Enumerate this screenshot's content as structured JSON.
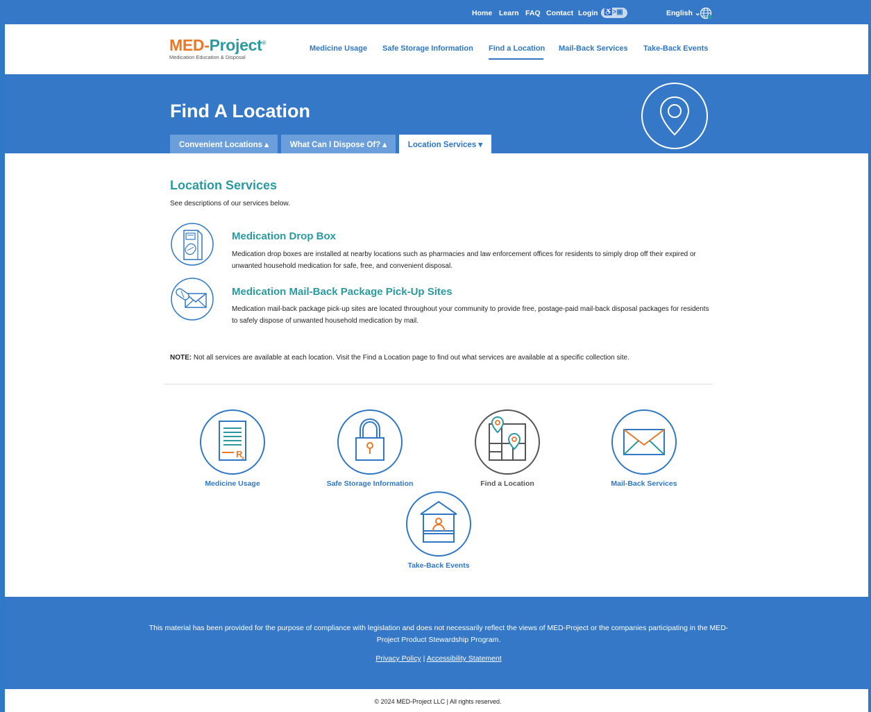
{
  "topbar": {
    "links": [
      "Home",
      "Learn",
      "FAQ",
      "Contact",
      "Login"
    ],
    "accessibility_badge": "♿>▣",
    "language": "English",
    "language_chevron": "⌄"
  },
  "header": {
    "logo_main_1": "MED-",
    "logo_main_2": "Project",
    "logo_reg": "®",
    "logo_sub": "Medication Education & Disposal",
    "nav": [
      "Medicine Usage",
      "Safe Storage Information",
      "Find a Location",
      "Mail-Back Services",
      "Take-Back Events"
    ],
    "active_nav": "Find a Location"
  },
  "hero": {
    "title": "Find A Location",
    "tabs": [
      "Convenient Locations ▴",
      "What Can I Dispose Of? ▴",
      "Location Services ▾"
    ],
    "active_tab": "Location Services"
  },
  "main": {
    "title": "Location Services",
    "intro": "See descriptions of our services below.",
    "services": [
      {
        "title": "Medication Drop Box",
        "description": "Medication drop boxes are installed at nearby locations such as pharmacies and law enforcement offices for residents to simply drop off their expired or unwanted household medication for safe, free, and convenient disposal.",
        "icon": "drop-box-icon"
      },
      {
        "title": "Medication Mail-Back Package Pick-Up Sites",
        "description": "Medication mail-back package pick-up sites are located throughout your community to provide free, postage-paid mail-back disposal packages for residents to safely dispose of unwanted household medication by mail.",
        "icon": "pill-envelope-icon"
      }
    ],
    "note_label": "NOTE:",
    "note_text": " Not all services are available at each location. Visit the Find a Location page to find out what services are available at a specific collection site."
  },
  "tiles": [
    {
      "label": "Medicine Usage",
      "icon": "prescription-icon"
    },
    {
      "label": "Safe Storage Information",
      "icon": "lock-icon"
    },
    {
      "label": "Find a Location",
      "icon": "map-pins-icon"
    },
    {
      "label": "Mail-Back Services",
      "icon": "envelope-icon"
    },
    {
      "label": "Take-Back Events",
      "icon": "take-back-booth-icon"
    }
  ],
  "footer": {
    "disclaimer": "This material has been provided for the purpose of compliance with legislation and does not necessarily reflect the views of MED-Project or the companies participating in the MED-Project Product Stewardship Program.",
    "privacy_link": "Privacy Policy",
    "link_separator": " | ",
    "accessibility_link": "Accessibility Statement",
    "copyright": "© 2024 MED-Project LLC | All rights reserved."
  },
  "colors": {
    "brand_blue": "#3578c8",
    "link_blue": "#2f77c4",
    "teal": "#2a9aa0",
    "orange": "#e97827"
  }
}
